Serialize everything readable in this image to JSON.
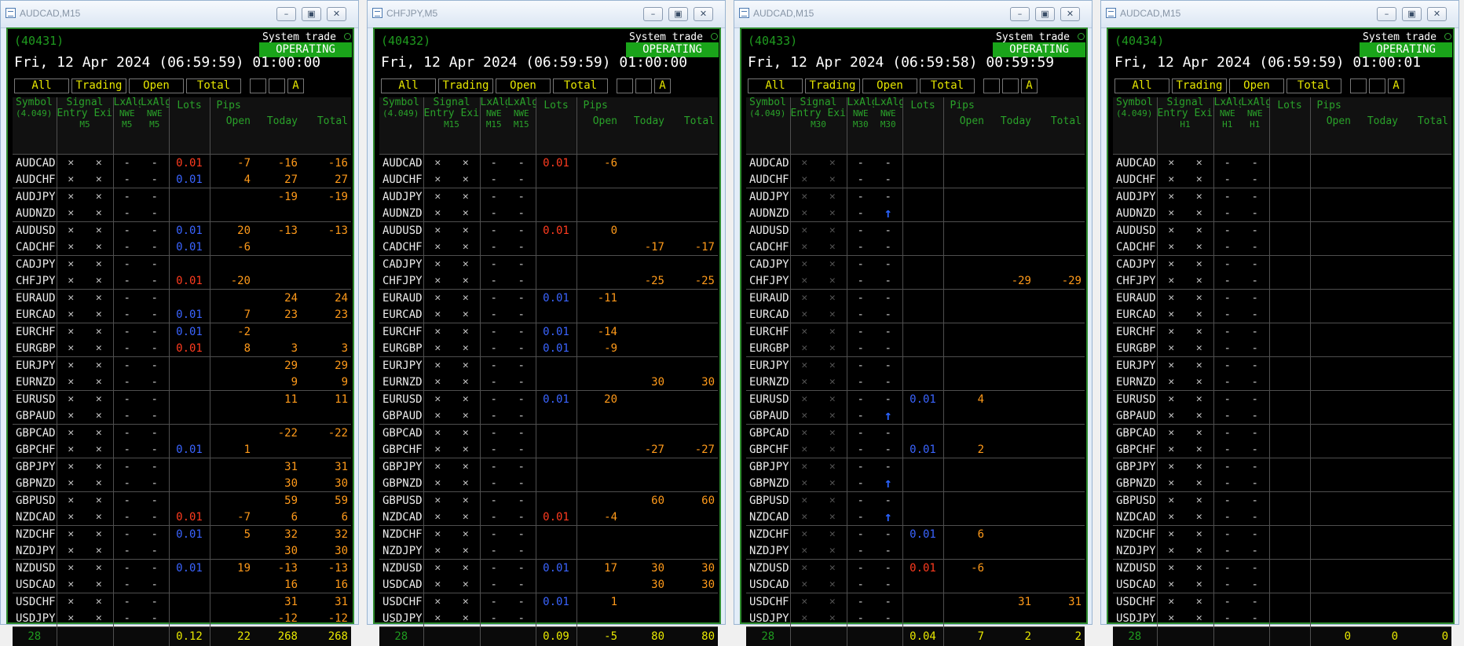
{
  "symbols": [
    "AUDCAD",
    "AUDCHF",
    "AUDJPY",
    "AUDNZD",
    "AUDUSD",
    "CADCHF",
    "CADJPY",
    "CHFJPY",
    "EURAUD",
    "EURCAD",
    "EURCHF",
    "EURGBP",
    "EURJPY",
    "EURNZD",
    "EURUSD",
    "GBPAUD",
    "GBPCAD",
    "GBPCHF",
    "GBPJPY",
    "GBPNZD",
    "GBPUSD",
    "NZDCAD",
    "NZDCHF",
    "NZDJPY",
    "NZDUSD",
    "USDCAD",
    "USDCHF",
    "USDJPY"
  ],
  "common": {
    "system_trade_label": "System trade",
    "status": "OPERATING",
    "filters": [
      "All",
      "Trading",
      "Open",
      "Total"
    ],
    "filter_a": "A",
    "header": {
      "symbol": "Symbol",
      "signal": "Signal",
      "entry": "Entry",
      "exit": "Exit",
      "lx1": "LxAlg",
      "nwe1": "NWE",
      "lx2": "LxAlg",
      "nwe2": "NWE",
      "lots": "Lots",
      "pips": "Pips",
      "open": "Open",
      "today": "Today",
      "total": "Total"
    },
    "icons": {
      "close": "x-mark-icon",
      "dash": "dash",
      "arrow": "arrow-up-icon",
      "window": "chart-window-icon"
    },
    "colors": {
      "frame": "#2e8b2e",
      "operating": "#1aa41a",
      "lots_red": "#ff3b1f",
      "lots_blue": "#3a64ff",
      "pips": "#ff9a1a",
      "footer": "#e8e800"
    }
  },
  "windows": [
    {
      "title": "AUDCAD,M15",
      "id": "(40431)",
      "datetime": "Fri, 12 Apr 2024 (06:59:59) 01:00:00",
      "version": "(4.049)",
      "timeframe": "M5",
      "signal_dim": false,
      "rows": [
        {
          "lots": "0.01",
          "lc": "red",
          "open": "-7",
          "today": "-16",
          "total": "-16"
        },
        {
          "lots": "0.01",
          "lc": "blue",
          "open": "4",
          "today": "27",
          "total": "27"
        },
        {
          "lots": "",
          "lc": "",
          "open": "",
          "today": "-19",
          "total": "-19"
        },
        {
          "lots": "",
          "lc": "",
          "open": "",
          "today": "",
          "total": ""
        },
        {
          "lots": "0.01",
          "lc": "blue",
          "open": "20",
          "today": "-13",
          "total": "-13"
        },
        {
          "lots": "0.01",
          "lc": "blue",
          "open": "-6",
          "today": "",
          "total": ""
        },
        {
          "lots": "",
          "lc": "",
          "open": "",
          "today": "",
          "total": ""
        },
        {
          "lots": "0.01",
          "lc": "red",
          "open": "-20",
          "today": "",
          "total": ""
        },
        {
          "lots": "",
          "lc": "",
          "open": "",
          "today": "24",
          "total": "24"
        },
        {
          "lots": "0.01",
          "lc": "blue",
          "open": "7",
          "today": "23",
          "total": "23"
        },
        {
          "lots": "0.01",
          "lc": "blue",
          "open": "-2",
          "today": "",
          "total": ""
        },
        {
          "lots": "0.01",
          "lc": "red",
          "open": "8",
          "today": "3",
          "total": "3"
        },
        {
          "lots": "",
          "lc": "",
          "open": "",
          "today": "29",
          "total": "29"
        },
        {
          "lots": "",
          "lc": "",
          "open": "",
          "today": "9",
          "total": "9"
        },
        {
          "lots": "",
          "lc": "",
          "open": "",
          "today": "11",
          "total": "11"
        },
        {
          "lots": "",
          "lc": "",
          "open": "",
          "today": "",
          "total": ""
        },
        {
          "lots": "",
          "lc": "",
          "open": "",
          "today": "-22",
          "total": "-22"
        },
        {
          "lots": "0.01",
          "lc": "blue",
          "open": "1",
          "today": "",
          "total": ""
        },
        {
          "lots": "",
          "lc": "",
          "open": "",
          "today": "31",
          "total": "31"
        },
        {
          "lots": "",
          "lc": "",
          "open": "",
          "today": "30",
          "total": "30"
        },
        {
          "lots": "",
          "lc": "",
          "open": "",
          "today": "59",
          "total": "59"
        },
        {
          "lots": "0.01",
          "lc": "red",
          "open": "-7",
          "today": "6",
          "total": "6"
        },
        {
          "lots": "0.01",
          "lc": "blue",
          "open": "5",
          "today": "32",
          "total": "32"
        },
        {
          "lots": "",
          "lc": "",
          "open": "",
          "today": "30",
          "total": "30"
        },
        {
          "lots": "0.01",
          "lc": "blue",
          "open": "19",
          "today": "-13",
          "total": "-13"
        },
        {
          "lots": "",
          "lc": "",
          "open": "",
          "today": "16",
          "total": "16"
        },
        {
          "lots": "",
          "lc": "",
          "open": "",
          "today": "31",
          "total": "31"
        },
        {
          "lots": "",
          "lc": "",
          "open": "",
          "today": "-12",
          "total": "-12"
        }
      ],
      "footer": {
        "count": "28",
        "lots": "0.12",
        "open": "22",
        "today": "268",
        "total": "268"
      }
    },
    {
      "title": "CHFJPY,M5",
      "id": "(40432)",
      "datetime": "Fri, 12 Apr 2024 (06:59:59) 01:00:00",
      "version": "(4.049)",
      "timeframe": "M15",
      "signal_dim": false,
      "rows": [
        {
          "lots": "0.01",
          "lc": "red",
          "open": "-6",
          "today": "",
          "total": ""
        },
        {
          "lots": "",
          "lc": "",
          "open": "",
          "today": "",
          "total": ""
        },
        {
          "lots": "",
          "lc": "",
          "open": "",
          "today": "",
          "total": ""
        },
        {
          "lots": "",
          "lc": "",
          "open": "",
          "today": "",
          "total": ""
        },
        {
          "lots": "0.01",
          "lc": "red",
          "open": "0",
          "today": "",
          "total": ""
        },
        {
          "lots": "",
          "lc": "",
          "open": "",
          "today": "-17",
          "total": "-17"
        },
        {
          "lots": "",
          "lc": "",
          "open": "",
          "today": "",
          "total": ""
        },
        {
          "lots": "",
          "lc": "",
          "open": "",
          "today": "-25",
          "total": "-25"
        },
        {
          "lots": "0.01",
          "lc": "blue",
          "open": "-11",
          "today": "",
          "total": ""
        },
        {
          "lots": "",
          "lc": "",
          "open": "",
          "today": "",
          "total": ""
        },
        {
          "lots": "0.01",
          "lc": "blue",
          "open": "-14",
          "today": "",
          "total": ""
        },
        {
          "lots": "0.01",
          "lc": "blue",
          "open": "-9",
          "today": "",
          "total": ""
        },
        {
          "lots": "",
          "lc": "",
          "open": "",
          "today": "",
          "total": ""
        },
        {
          "lots": "",
          "lc": "",
          "open": "",
          "today": "30",
          "total": "30"
        },
        {
          "lots": "0.01",
          "lc": "blue",
          "open": "20",
          "today": "",
          "total": ""
        },
        {
          "lots": "",
          "lc": "",
          "open": "",
          "today": "",
          "total": ""
        },
        {
          "lots": "",
          "lc": "",
          "open": "",
          "today": "",
          "total": ""
        },
        {
          "lots": "",
          "lc": "",
          "open": "",
          "today": "-27",
          "total": "-27"
        },
        {
          "lots": "",
          "lc": "",
          "open": "",
          "today": "",
          "total": ""
        },
        {
          "lots": "",
          "lc": "",
          "open": "",
          "today": "",
          "total": ""
        },
        {
          "lots": "",
          "lc": "",
          "open": "",
          "today": "60",
          "total": "60"
        },
        {
          "lots": "0.01",
          "lc": "red",
          "open": "-4",
          "today": "",
          "total": ""
        },
        {
          "lots": "",
          "lc": "",
          "open": "",
          "today": "",
          "total": ""
        },
        {
          "lots": "",
          "lc": "",
          "open": "",
          "today": "",
          "total": ""
        },
        {
          "lots": "0.01",
          "lc": "blue",
          "open": "17",
          "today": "30",
          "total": "30"
        },
        {
          "lots": "",
          "lc": "",
          "open": "",
          "today": "30",
          "total": "30"
        },
        {
          "lots": "0.01",
          "lc": "blue",
          "open": "1",
          "today": "",
          "total": ""
        },
        {
          "lots": "",
          "lc": "",
          "open": "",
          "today": "",
          "total": ""
        }
      ],
      "footer": {
        "count": "28",
        "lots": "0.09",
        "open": "-5",
        "today": "80",
        "total": "80"
      }
    },
    {
      "title": "AUDCAD,M15",
      "id": "(40433)",
      "datetime": "Fri, 12 Apr 2024 (06:59:58) 00:59:59",
      "version": "(4.049)",
      "timeframe": "M30",
      "signal_dim": true,
      "arrows": [
        3,
        15,
        19,
        21
      ],
      "rows": [
        {
          "lots": "",
          "lc": "",
          "open": "",
          "today": "",
          "total": ""
        },
        {
          "lots": "",
          "lc": "",
          "open": "",
          "today": "",
          "total": ""
        },
        {
          "lots": "",
          "lc": "",
          "open": "",
          "today": "",
          "total": ""
        },
        {
          "lots": "",
          "lc": "",
          "open": "",
          "today": "",
          "total": ""
        },
        {
          "lots": "",
          "lc": "",
          "open": "",
          "today": "",
          "total": ""
        },
        {
          "lots": "",
          "lc": "",
          "open": "",
          "today": "",
          "total": ""
        },
        {
          "lots": "",
          "lc": "",
          "open": "",
          "today": "",
          "total": ""
        },
        {
          "lots": "",
          "lc": "",
          "open": "",
          "today": "-29",
          "total": "-29"
        },
        {
          "lots": "",
          "lc": "",
          "open": "",
          "today": "",
          "total": ""
        },
        {
          "lots": "",
          "lc": "",
          "open": "",
          "today": "",
          "total": ""
        },
        {
          "lots": "",
          "lc": "",
          "open": "",
          "today": "",
          "total": ""
        },
        {
          "lots": "",
          "lc": "",
          "open": "",
          "today": "",
          "total": ""
        },
        {
          "lots": "",
          "lc": "",
          "open": "",
          "today": "",
          "total": ""
        },
        {
          "lots": "",
          "lc": "",
          "open": "",
          "today": "",
          "total": ""
        },
        {
          "lots": "0.01",
          "lc": "blue",
          "open": "4",
          "today": "",
          "total": ""
        },
        {
          "lots": "",
          "lc": "",
          "open": "",
          "today": "",
          "total": ""
        },
        {
          "lots": "",
          "lc": "",
          "open": "",
          "today": "",
          "total": ""
        },
        {
          "lots": "0.01",
          "lc": "blue",
          "open": "2",
          "today": "",
          "total": ""
        },
        {
          "lots": "",
          "lc": "",
          "open": "",
          "today": "",
          "total": ""
        },
        {
          "lots": "",
          "lc": "",
          "open": "",
          "today": "",
          "total": ""
        },
        {
          "lots": "",
          "lc": "",
          "open": "",
          "today": "",
          "total": ""
        },
        {
          "lots": "",
          "lc": "",
          "open": "",
          "today": "",
          "total": ""
        },
        {
          "lots": "0.01",
          "lc": "blue",
          "open": "6",
          "today": "",
          "total": ""
        },
        {
          "lots": "",
          "lc": "",
          "open": "",
          "today": "",
          "total": ""
        },
        {
          "lots": "0.01",
          "lc": "red",
          "open": "-6",
          "today": "",
          "total": ""
        },
        {
          "lots": "",
          "lc": "",
          "open": "",
          "today": "",
          "total": ""
        },
        {
          "lots": "",
          "lc": "",
          "open": "",
          "today": "31",
          "total": "31"
        },
        {
          "lots": "",
          "lc": "",
          "open": "",
          "today": "",
          "total": ""
        }
      ],
      "footer": {
        "count": "28",
        "lots": "0.04",
        "open": "7",
        "today": "2",
        "total": "2"
      }
    },
    {
      "title": "AUDCAD,M15",
      "id": "(40434)",
      "datetime": "Fri, 12 Apr 2024 (06:59:59) 01:00:01",
      "version": "(4.049)",
      "timeframe": "H1",
      "signal_dim": false,
      "rows": [
        {
          "lots": "",
          "lc": "",
          "open": "",
          "today": "",
          "total": ""
        },
        {
          "lots": "",
          "lc": "",
          "open": "",
          "today": "",
          "total": ""
        },
        {
          "lots": "",
          "lc": "",
          "open": "",
          "today": "",
          "total": ""
        },
        {
          "lots": "",
          "lc": "",
          "open": "",
          "today": "",
          "total": ""
        },
        {
          "lots": "",
          "lc": "",
          "open": "",
          "today": "",
          "total": ""
        },
        {
          "lots": "",
          "lc": "",
          "open": "",
          "today": "",
          "total": ""
        },
        {
          "lots": "",
          "lc": "",
          "open": "",
          "today": "",
          "total": ""
        },
        {
          "lots": "",
          "lc": "",
          "open": "",
          "today": "",
          "total": ""
        },
        {
          "lots": "",
          "lc": "",
          "open": "",
          "today": "",
          "total": ""
        },
        {
          "lots": "",
          "lc": "",
          "open": "",
          "today": "",
          "total": ""
        },
        {
          "lots": "",
          "lc": "",
          "open": "",
          "today": "",
          "total": ""
        },
        {
          "lots": "",
          "lc": "",
          "open": "",
          "today": "",
          "total": ""
        },
        {
          "lots": "",
          "lc": "",
          "open": "",
          "today": "",
          "total": ""
        },
        {
          "lots": "",
          "lc": "",
          "open": "",
          "today": "",
          "total": ""
        },
        {
          "lots": "",
          "lc": "",
          "open": "",
          "today": "",
          "total": ""
        },
        {
          "lots": "",
          "lc": "",
          "open": "",
          "today": "",
          "total": ""
        },
        {
          "lots": "",
          "lc": "",
          "open": "",
          "today": "",
          "total": ""
        },
        {
          "lots": "",
          "lc": "",
          "open": "",
          "today": "",
          "total": ""
        },
        {
          "lots": "",
          "lc": "",
          "open": "",
          "today": "",
          "total": ""
        },
        {
          "lots": "",
          "lc": "",
          "open": "",
          "today": "",
          "total": ""
        },
        {
          "lots": "",
          "lc": "",
          "open": "",
          "today": "",
          "total": ""
        },
        {
          "lots": "",
          "lc": "",
          "open": "",
          "today": "",
          "total": ""
        },
        {
          "lots": "",
          "lc": "",
          "open": "",
          "today": "",
          "total": ""
        },
        {
          "lots": "",
          "lc": "",
          "open": "",
          "today": "",
          "total": ""
        },
        {
          "lots": "",
          "lc": "",
          "open": "",
          "today": "",
          "total": ""
        },
        {
          "lots": "",
          "lc": "",
          "open": "",
          "today": "",
          "total": ""
        },
        {
          "lots": "",
          "lc": "",
          "open": "",
          "today": "",
          "total": ""
        },
        {
          "lots": "",
          "lc": "",
          "open": "",
          "today": "",
          "total": ""
        }
      ],
      "footer": {
        "count": "28",
        "lots": "",
        "open": "0",
        "today": "0",
        "total": "0"
      }
    }
  ]
}
